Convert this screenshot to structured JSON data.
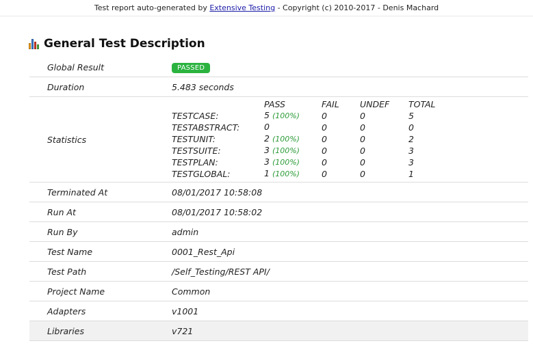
{
  "header": {
    "prefix": "Test report auto-generated by ",
    "link": "Extensive Testing",
    "suffix": " - Copyright (c) 2010-2017 - Denis Machard"
  },
  "section": {
    "title": "General Test Description",
    "icon": "bar-chart-icon"
  },
  "rows": {
    "global_result": {
      "label": "Global Result",
      "value": "PASSED",
      "badge_color": "#2bb33f"
    },
    "duration": {
      "label": "Duration",
      "value": "5.483 seconds"
    },
    "statistics": {
      "label": "Statistics"
    },
    "terminated_at": {
      "label": "Terminated At",
      "value": "08/01/2017 10:58:08"
    },
    "run_at": {
      "label": "Run At",
      "value": "08/01/2017 10:58:02"
    },
    "run_by": {
      "label": "Run By",
      "value": "admin"
    },
    "test_name": {
      "label": "Test Name",
      "value": "0001_Rest_Api"
    },
    "test_path": {
      "label": "Test Path",
      "value": "/Self_Testing/REST API/"
    },
    "project_name": {
      "label": "Project Name",
      "value": "Common"
    },
    "adapters": {
      "label": "Adapters",
      "value": "v1001"
    },
    "libraries": {
      "label": "Libraries",
      "value": "v721"
    }
  },
  "stats": {
    "headers": {
      "pass": "PASS",
      "fail": "FAIL",
      "undef": "UNDEF",
      "total": "TOTAL"
    },
    "rows": [
      {
        "name": "TESTCASE:",
        "pass": "5",
        "pct": "(100%)",
        "fail": "0",
        "undef": "0",
        "total": "5"
      },
      {
        "name": "TESTABSTRACT:",
        "pass": "0",
        "pct": "",
        "fail": "0",
        "undef": "0",
        "total": "0"
      },
      {
        "name": "TESTUNIT:",
        "pass": "2",
        "pct": "(100%)",
        "fail": "0",
        "undef": "0",
        "total": "2"
      },
      {
        "name": "TESTSUITE:",
        "pass": "3",
        "pct": "(100%)",
        "fail": "0",
        "undef": "0",
        "total": "3"
      },
      {
        "name": "TESTPLAN:",
        "pass": "3",
        "pct": "(100%)",
        "fail": "0",
        "undef": "0",
        "total": "3"
      },
      {
        "name": "TESTGLOBAL:",
        "pass": "1",
        "pct": "(100%)",
        "fail": "0",
        "undef": "0",
        "total": "1"
      }
    ]
  },
  "colors": {
    "pass_percent": "#2a9a36",
    "link": "#1a1aa6",
    "highlight_row": "#f1f1f1"
  }
}
